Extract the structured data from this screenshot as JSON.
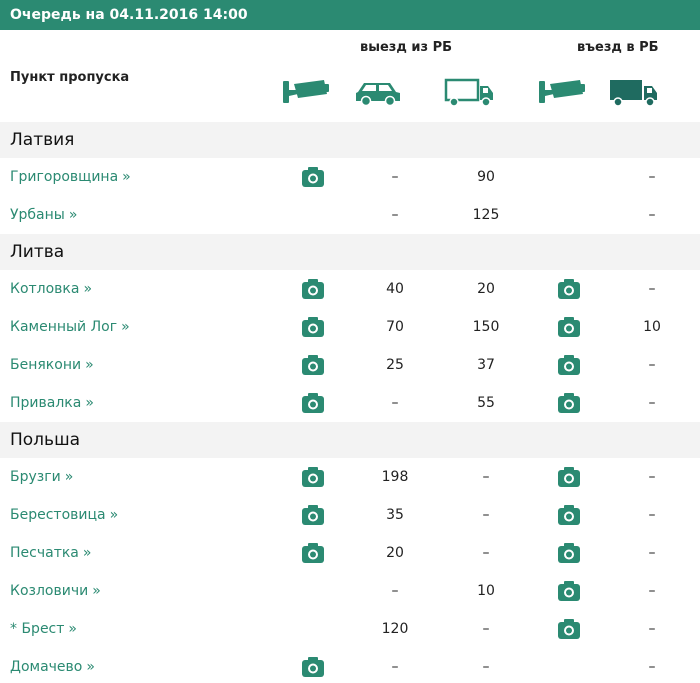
{
  "title": "Очередь на 04.11.2016 14:00",
  "header": {
    "point_label": "Пункт пропуска",
    "exit_label": "выезд из РБ",
    "entry_label": "въезд в РБ"
  },
  "icons": {
    "exit_camera": "camera-icon",
    "exit_car": "car-icon",
    "exit_truck": "truck-icon",
    "entry_camera": "camera-icon",
    "entry_truck": "truck-icon"
  },
  "colors": {
    "accent": "#2b8a72",
    "section_bg": "#f3f3f3"
  },
  "groups": [
    {
      "name": "Латвия",
      "points": [
        {
          "name": "Григоровщина",
          "chevron": "»",
          "exit_cam": true,
          "car": "–",
          "truck": "90",
          "entry_cam": false,
          "entry_truck": "–"
        },
        {
          "name": "Урбаны",
          "chevron": "»",
          "exit_cam": false,
          "car": "–",
          "truck": "125",
          "entry_cam": false,
          "entry_truck": "–"
        }
      ]
    },
    {
      "name": "Литва",
      "points": [
        {
          "name": "Котловка",
          "chevron": "»",
          "exit_cam": true,
          "car": "40",
          "truck": "20",
          "entry_cam": true,
          "entry_truck": "–"
        },
        {
          "name": "Каменный Лог",
          "chevron": "»",
          "exit_cam": true,
          "car": "70",
          "truck": "150",
          "entry_cam": true,
          "entry_truck": "10"
        },
        {
          "name": "Бенякони",
          "chevron": "»",
          "exit_cam": true,
          "car": "25",
          "truck": "37",
          "entry_cam": true,
          "entry_truck": "–"
        },
        {
          "name": "Привалка",
          "chevron": "»",
          "exit_cam": true,
          "car": "–",
          "truck": "55",
          "entry_cam": true,
          "entry_truck": "–"
        }
      ]
    },
    {
      "name": "Польша",
      "points": [
        {
          "name": "Брузги",
          "chevron": "»",
          "exit_cam": true,
          "car": "198",
          "truck": "–",
          "entry_cam": true,
          "entry_truck": "–"
        },
        {
          "name": "Берестовица",
          "chevron": "»",
          "exit_cam": true,
          "car": "35",
          "truck": "–",
          "entry_cam": true,
          "entry_truck": "–"
        },
        {
          "name": "Песчатка",
          "chevron": "»",
          "exit_cam": true,
          "car": "20",
          "truck": "–",
          "entry_cam": true,
          "entry_truck": "–"
        },
        {
          "name": "Козловичи",
          "chevron": "»",
          "exit_cam": false,
          "car": "–",
          "truck": "10",
          "entry_cam": true,
          "entry_truck": "–"
        },
        {
          "name": "* Брест",
          "chevron": "»",
          "exit_cam": false,
          "car": "120",
          "truck": "–",
          "entry_cam": true,
          "entry_truck": "–"
        },
        {
          "name": "Домачево",
          "chevron": "»",
          "exit_cam": true,
          "car": "–",
          "truck": "–",
          "entry_cam": false,
          "entry_truck": "–"
        }
      ]
    }
  ]
}
